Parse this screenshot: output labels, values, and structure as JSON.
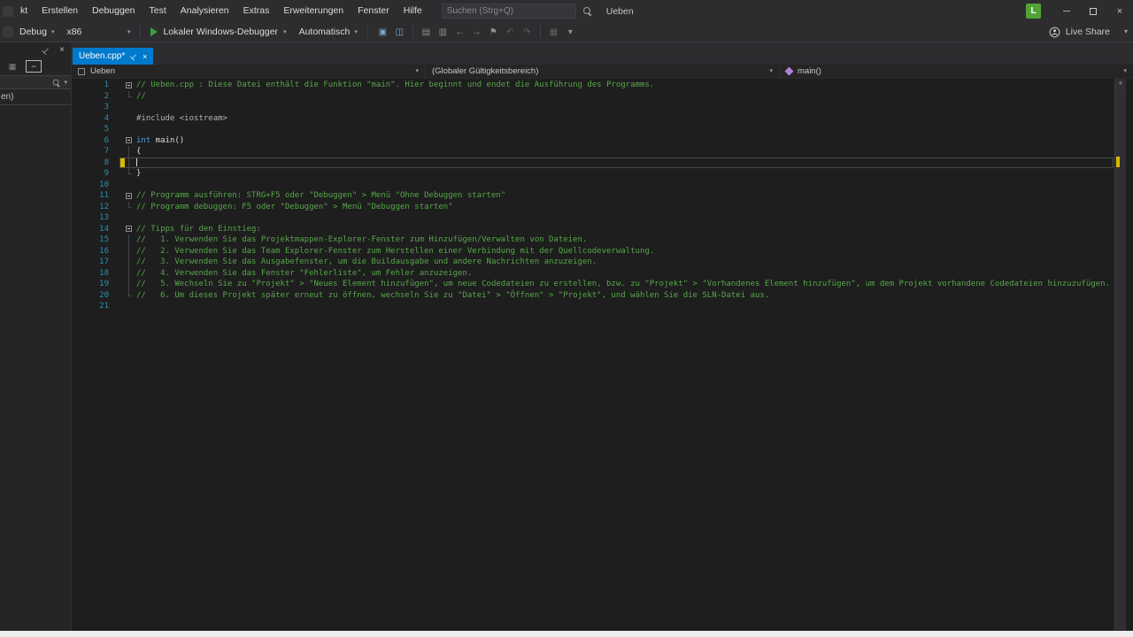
{
  "colors": {
    "accent_blue": "#007acc",
    "comment_green": "#57a64a",
    "keyword_blue": "#569cd6",
    "line_number_teal": "#2b91af",
    "modified_yellow": "#d7ba00",
    "avatar_green": "#52a336",
    "editor_background": "#1e1e1e"
  },
  "icons": {
    "pin": "⊣",
    "close": "×",
    "chevron_down": "▾",
    "minimize": "─",
    "plus": "+",
    "minus": "−",
    "grid": "▦"
  },
  "menubar": {
    "items": [
      "kt",
      "Erstellen",
      "Debuggen",
      "Test",
      "Analysieren",
      "Extras",
      "Erweiterungen",
      "Fenster",
      "Hilfe"
    ],
    "search_placeholder": "Suchen (Strg+Q)",
    "window_title": "Ueben",
    "avatar_letter": "L"
  },
  "toolbar": {
    "config": "Debug",
    "platform": "x86",
    "debug_target": "Lokaler Windows-Debugger",
    "auto_combo": "Automatisch",
    "live_share": "Live Share",
    "icons": [
      {
        "name": "process-selector-icon",
        "glyph": "▣",
        "color": "#7aa5c9"
      },
      {
        "name": "snapshot-icon",
        "glyph": "◫",
        "color": "#7aa5c9"
      },
      {
        "sep": true
      },
      {
        "name": "comment-lines-icon",
        "glyph": "▤",
        "color": "#8f8f8f"
      },
      {
        "name": "uncomment-lines-icon",
        "glyph": "▥",
        "color": "#8f8f8f"
      },
      {
        "name": "decrease-indent-icon",
        "glyph": "←",
        "color": "#8f8f8f"
      },
      {
        "name": "increase-indent-icon",
        "glyph": "→",
        "color": "#8f8f8f"
      },
      {
        "name": "bookmark-icon",
        "glyph": "⚑",
        "color": "#8f8f8f"
      },
      {
        "name": "previous-bookmark-icon",
        "glyph": "↶",
        "color": "#5f5f5f"
      },
      {
        "name": "next-bookmark-icon",
        "glyph": "↷",
        "color": "#5f5f5f"
      },
      {
        "sep": true
      },
      {
        "name": "bookmark-window-icon",
        "glyph": "▦",
        "color": "#5f5f5f"
      },
      {
        "name": "toolbar-options-chevron-icon",
        "glyph": "▾",
        "color": "#8f8f8f"
      }
    ]
  },
  "left_panel": {
    "truncated_text": "en)"
  },
  "tab": {
    "title": "Ueben.cpp*"
  },
  "navbar": {
    "project": "Ueben",
    "scope": "(Globaler Gültigkeitsbereich)",
    "member": "main()"
  },
  "editor": {
    "lines": [
      {
        "n": 1,
        "fold": true,
        "tokens": [
          {
            "c": "comment",
            "t": "// Ueben.cpp : Diese Datei enthält die Funktion \"main\". Hier beginnt und endet die Ausführung des Programms."
          }
        ]
      },
      {
        "n": 2,
        "guide": true,
        "guide_end": true,
        "tokens": [
          {
            "c": "comment",
            "t": "//"
          }
        ]
      },
      {
        "n": 3,
        "tokens": []
      },
      {
        "n": 4,
        "tokens": [
          {
            "c": "pp",
            "t": "#include <iostream>"
          }
        ]
      },
      {
        "n": 5,
        "tokens": []
      },
      {
        "n": 6,
        "fold": true,
        "tokens": [
          {
            "c": "kw",
            "t": "int"
          },
          {
            "c": "plain",
            "t": " main()"
          }
        ]
      },
      {
        "n": 7,
        "guide": true,
        "tokens": [
          {
            "c": "plain",
            "t": "{"
          }
        ]
      },
      {
        "n": 8,
        "guide": true,
        "current": true,
        "modified": true,
        "tokens": []
      },
      {
        "n": 9,
        "guide": true,
        "guide_end": true,
        "tokens": [
          {
            "c": "plain",
            "t": "}"
          }
        ]
      },
      {
        "n": 10,
        "tokens": []
      },
      {
        "n": 11,
        "fold": true,
        "tokens": [
          {
            "c": "comment",
            "t": "// Programm ausführen: STRG+F5 oder \"Debuggen\" > Menü \"Ohne Debuggen starten\""
          }
        ]
      },
      {
        "n": 12,
        "guide": true,
        "guide_end": true,
        "tokens": [
          {
            "c": "comment",
            "t": "// Programm debuggen: F5 oder \"Debuggen\" > Menü \"Debuggen starten\""
          }
        ]
      },
      {
        "n": 13,
        "tokens": []
      },
      {
        "n": 14,
        "fold": true,
        "tokens": [
          {
            "c": "comment",
            "t": "// Tipps für den Einstieg: "
          }
        ]
      },
      {
        "n": 15,
        "guide": true,
        "tokens": [
          {
            "c": "comment",
            "t": "//   1. Verwenden Sie das Projektmappen-Explorer-Fenster zum Hinzufügen/Verwalten von Dateien."
          }
        ]
      },
      {
        "n": 16,
        "guide": true,
        "tokens": [
          {
            "c": "comment",
            "t": "//   2. Verwenden Sie das Team Explorer-Fenster zum Herstellen einer Verbindung mit der Quellcodeverwaltung."
          }
        ]
      },
      {
        "n": 17,
        "guide": true,
        "tokens": [
          {
            "c": "comment",
            "t": "//   3. Verwenden Sie das Ausgabefenster, um die Buildausgabe und andere Nachrichten anzuzeigen."
          }
        ]
      },
      {
        "n": 18,
        "guide": true,
        "tokens": [
          {
            "c": "comment",
            "t": "//   4. Verwenden Sie das Fenster \"Fehlerliste\", um Fehler anzuzeigen."
          }
        ]
      },
      {
        "n": 19,
        "guide": true,
        "tokens": [
          {
            "c": "comment",
            "t": "//   5. Wechseln Sie zu \"Projekt\" > \"Neues Element hinzufügen\", um neue Codedateien zu erstellen, bzw. zu \"Projekt\" > \"Vorhandenes Element hinzufügen\", um dem Projekt vorhandene Codedateien hinzuzufügen."
          }
        ]
      },
      {
        "n": 20,
        "guide": true,
        "guide_end": true,
        "tokens": [
          {
            "c": "comment",
            "t": "//   6. Um dieses Projekt später erneut zu öffnen, wechseln Sie zu \"Datei\" > \"Öffnen\" > \"Projekt\", und wählen Sie die SLN-Datei aus."
          }
        ]
      },
      {
        "n": 21,
        "tokens": []
      }
    ]
  }
}
